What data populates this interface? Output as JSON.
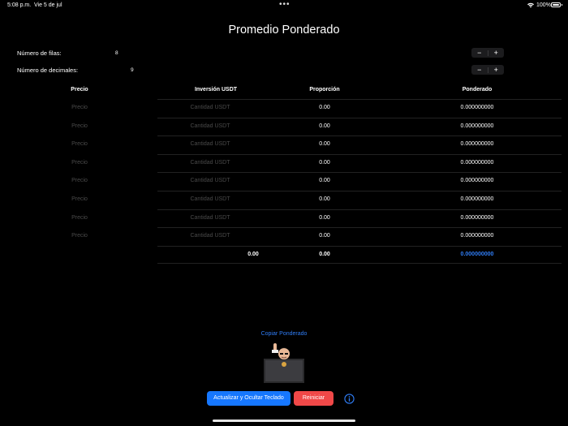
{
  "status_bar": {
    "time": "5:08 p.m.",
    "date": "Vie 5 de jul",
    "dots": "•••",
    "battery": "100%"
  },
  "title": "Promedio Ponderado",
  "settings": {
    "rows_label": "Número de filas:",
    "rows_value": "8",
    "decimals_label": "Número de decimales:",
    "decimals_value": "9",
    "minus": "−",
    "plus": "+"
  },
  "table": {
    "headers": [
      "Precio",
      "Inversión USDT",
      "Proporción",
      "Ponderado"
    ],
    "rows": [
      {
        "price_placeholder": "Precio",
        "investment_placeholder": "Cantidad USDT",
        "proportion": "0.00",
        "weighted": "0.000000000"
      },
      {
        "price_placeholder": "Precio",
        "investment_placeholder": "Cantidad USDT",
        "proportion": "0.00",
        "weighted": "0.000000000"
      },
      {
        "price_placeholder": "Precio",
        "investment_placeholder": "Cantidad USDT",
        "proportion": "0.00",
        "weighted": "0.000000000"
      },
      {
        "price_placeholder": "Precio",
        "investment_placeholder": "Cantidad USDT",
        "proportion": "0.00",
        "weighted": "0.000000000"
      },
      {
        "price_placeholder": "Precio",
        "investment_placeholder": "Cantidad USDT",
        "proportion": "0.00",
        "weighted": "0.000000000"
      },
      {
        "price_placeholder": "Precio",
        "investment_placeholder": "Cantidad USDT",
        "proportion": "0.00",
        "weighted": "0.000000000"
      },
      {
        "price_placeholder": "Precio",
        "investment_placeholder": "Cantidad USDT",
        "proportion": "0.00",
        "weighted": "0.000000000"
      },
      {
        "price_placeholder": "Precio",
        "investment_placeholder": "Cantidad USDT",
        "proportion": "0.00",
        "weighted": "0.000000000"
      }
    ],
    "totals": {
      "investment": "0.00",
      "proportion": "0.00",
      "weighted": "0.000000000"
    }
  },
  "copy_link": "Copiar Ponderado",
  "buttons": {
    "update": "Actualizar y Ocultar Teclado",
    "reset": "Reiniciar"
  },
  "colors": {
    "accent": "#1677ff",
    "danger": "#f04848",
    "link": "#2f7df6"
  },
  "icons": [
    "wifi-icon",
    "battery-icon",
    "memoji-icon",
    "info-icon"
  ]
}
